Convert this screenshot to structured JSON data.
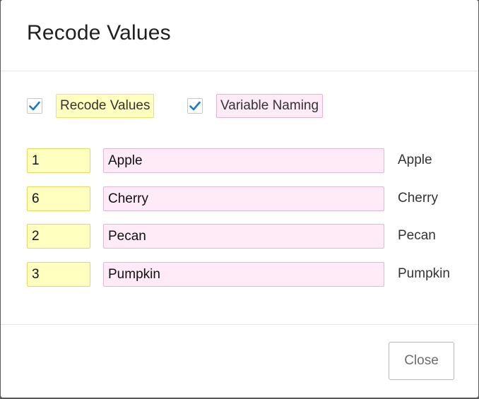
{
  "dialog": {
    "title": "Recode Values",
    "options": {
      "recode_values": {
        "label": "Recode Values",
        "checked": true
      },
      "variable_naming": {
        "label": "Variable Naming",
        "checked": true
      }
    },
    "rows": [
      {
        "recode_value": "1",
        "variable_name": "Apple",
        "original_label": "Apple"
      },
      {
        "recode_value": "6",
        "variable_name": "Cherry",
        "original_label": "Cherry"
      },
      {
        "recode_value": "2",
        "variable_name": "Pecan",
        "original_label": "Pecan"
      },
      {
        "recode_value": "3",
        "variable_name": "Pumpkin",
        "original_label": "Pumpkin"
      }
    ],
    "close_label": "Close"
  },
  "colors": {
    "recode_highlight": "#ffffc0",
    "naming_highlight": "#ffeaf7",
    "checkmark": "#1a7ac8"
  }
}
